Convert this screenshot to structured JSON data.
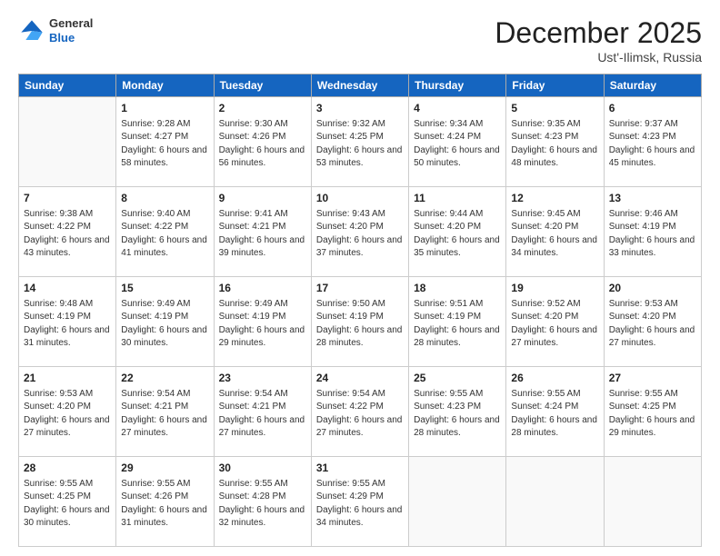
{
  "header": {
    "logo_general": "General",
    "logo_blue": "Blue",
    "month_title": "December 2025",
    "location": "Ust'-Ilimsk, Russia"
  },
  "weekdays": [
    "Sunday",
    "Monday",
    "Tuesday",
    "Wednesday",
    "Thursday",
    "Friday",
    "Saturday"
  ],
  "weeks": [
    [
      {
        "day": "",
        "sunrise": "",
        "sunset": "",
        "daylight": ""
      },
      {
        "day": "1",
        "sunrise": "9:28 AM",
        "sunset": "4:27 PM",
        "daylight": "6 hours and 58 minutes."
      },
      {
        "day": "2",
        "sunrise": "9:30 AM",
        "sunset": "4:26 PM",
        "daylight": "6 hours and 56 minutes."
      },
      {
        "day": "3",
        "sunrise": "9:32 AM",
        "sunset": "4:25 PM",
        "daylight": "6 hours and 53 minutes."
      },
      {
        "day": "4",
        "sunrise": "9:34 AM",
        "sunset": "4:24 PM",
        "daylight": "6 hours and 50 minutes."
      },
      {
        "day": "5",
        "sunrise": "9:35 AM",
        "sunset": "4:23 PM",
        "daylight": "6 hours and 48 minutes."
      },
      {
        "day": "6",
        "sunrise": "9:37 AM",
        "sunset": "4:23 PM",
        "daylight": "6 hours and 45 minutes."
      }
    ],
    [
      {
        "day": "7",
        "sunrise": "9:38 AM",
        "sunset": "4:22 PM",
        "daylight": "6 hours and 43 minutes."
      },
      {
        "day": "8",
        "sunrise": "9:40 AM",
        "sunset": "4:22 PM",
        "daylight": "6 hours and 41 minutes."
      },
      {
        "day": "9",
        "sunrise": "9:41 AM",
        "sunset": "4:21 PM",
        "daylight": "6 hours and 39 minutes."
      },
      {
        "day": "10",
        "sunrise": "9:43 AM",
        "sunset": "4:20 PM",
        "daylight": "6 hours and 37 minutes."
      },
      {
        "day": "11",
        "sunrise": "9:44 AM",
        "sunset": "4:20 PM",
        "daylight": "6 hours and 35 minutes."
      },
      {
        "day": "12",
        "sunrise": "9:45 AM",
        "sunset": "4:20 PM",
        "daylight": "6 hours and 34 minutes."
      },
      {
        "day": "13",
        "sunrise": "9:46 AM",
        "sunset": "4:19 PM",
        "daylight": "6 hours and 33 minutes."
      }
    ],
    [
      {
        "day": "14",
        "sunrise": "9:48 AM",
        "sunset": "4:19 PM",
        "daylight": "6 hours and 31 minutes."
      },
      {
        "day": "15",
        "sunrise": "9:49 AM",
        "sunset": "4:19 PM",
        "daylight": "6 hours and 30 minutes."
      },
      {
        "day": "16",
        "sunrise": "9:49 AM",
        "sunset": "4:19 PM",
        "daylight": "6 hours and 29 minutes."
      },
      {
        "day": "17",
        "sunrise": "9:50 AM",
        "sunset": "4:19 PM",
        "daylight": "6 hours and 28 minutes."
      },
      {
        "day": "18",
        "sunrise": "9:51 AM",
        "sunset": "4:19 PM",
        "daylight": "6 hours and 28 minutes."
      },
      {
        "day": "19",
        "sunrise": "9:52 AM",
        "sunset": "4:20 PM",
        "daylight": "6 hours and 27 minutes."
      },
      {
        "day": "20",
        "sunrise": "9:53 AM",
        "sunset": "4:20 PM",
        "daylight": "6 hours and 27 minutes."
      }
    ],
    [
      {
        "day": "21",
        "sunrise": "9:53 AM",
        "sunset": "4:20 PM",
        "daylight": "6 hours and 27 minutes."
      },
      {
        "day": "22",
        "sunrise": "9:54 AM",
        "sunset": "4:21 PM",
        "daylight": "6 hours and 27 minutes."
      },
      {
        "day": "23",
        "sunrise": "9:54 AM",
        "sunset": "4:21 PM",
        "daylight": "6 hours and 27 minutes."
      },
      {
        "day": "24",
        "sunrise": "9:54 AM",
        "sunset": "4:22 PM",
        "daylight": "6 hours and 27 minutes."
      },
      {
        "day": "25",
        "sunrise": "9:55 AM",
        "sunset": "4:23 PM",
        "daylight": "6 hours and 28 minutes."
      },
      {
        "day": "26",
        "sunrise": "9:55 AM",
        "sunset": "4:24 PM",
        "daylight": "6 hours and 28 minutes."
      },
      {
        "day": "27",
        "sunrise": "9:55 AM",
        "sunset": "4:25 PM",
        "daylight": "6 hours and 29 minutes."
      }
    ],
    [
      {
        "day": "28",
        "sunrise": "9:55 AM",
        "sunset": "4:25 PM",
        "daylight": "6 hours and 30 minutes."
      },
      {
        "day": "29",
        "sunrise": "9:55 AM",
        "sunset": "4:26 PM",
        "daylight": "6 hours and 31 minutes."
      },
      {
        "day": "30",
        "sunrise": "9:55 AM",
        "sunset": "4:28 PM",
        "daylight": "6 hours and 32 minutes."
      },
      {
        "day": "31",
        "sunrise": "9:55 AM",
        "sunset": "4:29 PM",
        "daylight": "6 hours and 34 minutes."
      },
      {
        "day": "",
        "sunrise": "",
        "sunset": "",
        "daylight": ""
      },
      {
        "day": "",
        "sunrise": "",
        "sunset": "",
        "daylight": ""
      },
      {
        "day": "",
        "sunrise": "",
        "sunset": "",
        "daylight": ""
      }
    ]
  ]
}
